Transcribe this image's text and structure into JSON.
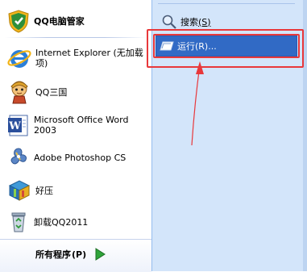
{
  "left_pinned": [
    {
      "label": "QQ电脑管家",
      "icon": "qq-pc-manager-icon"
    }
  ],
  "left_recent": [
    {
      "label": "Internet Explorer (无加载项)",
      "icon": "internet-explorer-icon"
    },
    {
      "label": "QQ三国",
      "icon": "qq-sanguo-icon"
    },
    {
      "label": "Microsoft Office Word 2003",
      "icon": "word-icon"
    },
    {
      "label": "Adobe Photoshop CS",
      "icon": "photoshop-icon"
    },
    {
      "label": "好压",
      "icon": "haozip-icon"
    },
    {
      "label": "卸载QQ2011",
      "icon": "recycle-bin-icon"
    }
  ],
  "all_programs": {
    "label_text": "所有程序",
    "label_key": "(P)",
    "icon": "green-arrow-icon"
  },
  "right": {
    "search": {
      "label": "搜索",
      "key": "(S)",
      "icon": "search-icon"
    },
    "run": {
      "label": "运行",
      "key": "(R)...",
      "icon": "run-icon"
    }
  },
  "colors": {
    "highlight": "#316ac5",
    "annotation": "#e8383b",
    "right_pane": "#d3e5fa"
  }
}
